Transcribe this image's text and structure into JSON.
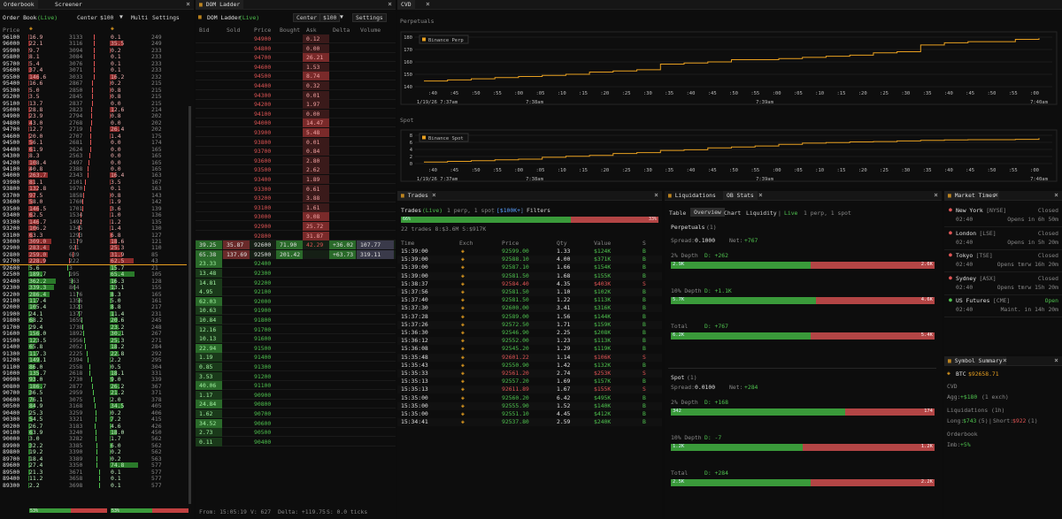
{
  "ob": {
    "tab1": "Orderbook",
    "tab2": "Screener",
    "title": "Order Book",
    "live": "(Live)",
    "center": "Center",
    "size": "$100",
    "multi": "Multi",
    "settings": "Settings",
    "price_hdr": "Price",
    "mid_price": "92700",
    "asks": [
      [
        "96100",
        "16.9",
        "3133",
        "0.1",
        "249"
      ],
      [
        "96000",
        "22.1",
        "3116",
        "35.5",
        "249"
      ],
      [
        "95900",
        "9.7",
        "3094",
        "0.2",
        "233"
      ],
      [
        "95800",
        "8.1",
        "3084",
        "0.1",
        "233"
      ],
      [
        "95700",
        "5.4",
        "3076",
        "0.1",
        "233"
      ],
      [
        "95600",
        "37.4",
        "3071",
        "0.1",
        "233"
      ],
      [
        "95500",
        "146.6",
        "3033",
        "16.2",
        "232"
      ],
      [
        "95400",
        "16.6",
        "2867",
        "0.2",
        "215"
      ],
      [
        "95300",
        "5.0",
        "2850",
        "0.8",
        "215"
      ],
      [
        "95200",
        "3.5",
        "2845",
        "0.8",
        "215"
      ],
      [
        "95100",
        "13.7",
        "2837",
        "0.0",
        "215"
      ],
      [
        "95000",
        "28.8",
        "2823",
        "12.6",
        "214"
      ],
      [
        "94900",
        "23.9",
        "2794",
        "0.8",
        "202"
      ],
      [
        "94800",
        "43.0",
        "2768",
        "0.0",
        "202"
      ],
      [
        "94700",
        "12.7",
        "2719",
        "26.4",
        "202"
      ],
      [
        "94600",
        "20.0",
        "2707",
        "1.4",
        "175"
      ],
      [
        "94500",
        "56.1",
        "2681",
        "0.0",
        "174"
      ],
      [
        "94400",
        "61.9",
        "2624",
        "0.0",
        "165"
      ],
      [
        "94300",
        "8.3",
        "2563",
        "0.0",
        "165"
      ],
      [
        "94200",
        "108.4",
        "2497",
        "0.0",
        "165"
      ],
      [
        "94100",
        "40.8",
        "2388",
        "0.0",
        "165"
      ],
      [
        "94000",
        "263.7",
        "2343",
        "16.4",
        "163"
      ],
      [
        "93900",
        "81.1",
        "2101",
        "3.5",
        "167"
      ],
      [
        "93800",
        "132.8",
        "1970",
        "0.1",
        "163"
      ],
      [
        "93700",
        "97.5",
        "1858",
        "0.8",
        "143"
      ],
      [
        "93600",
        "58.0",
        "1760",
        "1.9",
        "142"
      ],
      [
        "93500",
        "146.5",
        "1701",
        "3.6",
        "139"
      ],
      [
        "93400",
        "62.5",
        "1534",
        "1.0",
        "136"
      ],
      [
        "93300",
        "146.7",
        "1492",
        "1.2",
        "135"
      ],
      [
        "93200",
        "106.2",
        "1345",
        "1.4",
        "130"
      ],
      [
        "93100",
        "63.3",
        "1293",
        "6.8",
        "127"
      ],
      [
        "93000",
        "309.0",
        "1179",
        "18.6",
        "121"
      ],
      [
        "92900",
        "283.4",
        "921",
        "25.3",
        "110"
      ],
      [
        "92800",
        "259.0",
        "639",
        "31.9",
        "85"
      ],
      [
        "92700",
        "228.9",
        "222",
        "62.5",
        "43"
      ]
    ],
    "bids": [
      [
        "92600",
        "5.6",
        "3",
        "15.7",
        "21"
      ],
      [
        "92500",
        "189.7",
        "195",
        "65.4",
        "105"
      ],
      [
        "92400",
        "362.2",
        "563",
        "16.3",
        "128"
      ],
      [
        "92300",
        "339.3",
        "864",
        "13.1",
        "155"
      ],
      [
        "92200",
        "286.4",
        "1176",
        "8.3",
        "165"
      ],
      [
        "92100",
        "117.4",
        "1356",
        "5.0",
        "161"
      ],
      [
        "92000",
        "105.4",
        "1323",
        "8.8",
        "217"
      ],
      [
        "91900",
        "24.1",
        "1377",
        "11.4",
        "231"
      ],
      [
        "91800",
        "68.2",
        "1659",
        "20.6",
        "245"
      ],
      [
        "91700",
        "29.4",
        "1738",
        "23.2",
        "248"
      ],
      [
        "91600",
        "156.0",
        "1892",
        "30.1",
        "267"
      ],
      [
        "91500",
        "123.5",
        "1956",
        "25.3",
        "271"
      ],
      [
        "91400",
        "65.8",
        "2052",
        "18.2",
        "284"
      ],
      [
        "91300",
        "117.3",
        "2225",
        "22.8",
        "292"
      ],
      [
        "91200",
        "149.1",
        "2394",
        "2.2",
        "295"
      ],
      [
        "91100",
        "86.0",
        "2558",
        "0.5",
        "304"
      ],
      [
        "91000",
        "135.7",
        "2618",
        "18.1",
        "331"
      ],
      [
        "90900",
        "93.0",
        "2730",
        "9.0",
        "339"
      ],
      [
        "90800",
        "186.7",
        "2877",
        "26.2",
        "367"
      ],
      [
        "90700",
        "36.5",
        "2959",
        "21.2",
        "371"
      ],
      [
        "90600",
        "76.1",
        "3075",
        "2.0",
        "378"
      ],
      [
        "90500",
        "84.9",
        "3168",
        "34.5",
        "405"
      ],
      [
        "90400",
        "25.3",
        "3259",
        "0.2",
        "406"
      ],
      [
        "90300",
        "54.5",
        "3321",
        "7.2",
        "415"
      ],
      [
        "90200",
        "26.7",
        "3183",
        "4.6",
        "426"
      ],
      [
        "90100",
        "63.9",
        "3240",
        "18.0",
        "450"
      ],
      [
        "90000",
        "3.0",
        "3282",
        "1.7",
        "562"
      ],
      [
        "89900",
        "32.2",
        "3385",
        "6.0",
        "562"
      ],
      [
        "89800",
        "19.2",
        "3390",
        "0.2",
        "562"
      ],
      [
        "89700",
        "18.4",
        "3389",
        "0.2",
        "563"
      ],
      [
        "89600",
        "27.4",
        "3350",
        "74.8",
        "577"
      ],
      [
        "89500",
        "21.3",
        "3671",
        "0.1",
        "577"
      ],
      [
        "89400",
        "11.2",
        "3658",
        "0.1",
        "577"
      ],
      [
        "89300",
        "2.2",
        "3698",
        "0.1",
        "577"
      ]
    ],
    "foot1": "53%",
    "foot2": "53%"
  },
  "dom": {
    "tab": "DOM Ladder",
    "title": "DOM Ladder",
    "live": "(Live)",
    "center": "Center",
    "size": "$100",
    "settings": "Settings",
    "cols": [
      "Bid",
      "Sold",
      "Price",
      "Bought",
      "Ask",
      "Delta",
      "Volume"
    ],
    "asks": [
      [
        "94900",
        "0.12"
      ],
      [
        "94800",
        "0.00"
      ],
      [
        "94700",
        "26.21"
      ],
      [
        "94600",
        "1.53"
      ],
      [
        "94500",
        "8.74"
      ],
      [
        "94400",
        "0.32"
      ],
      [
        "94300",
        "0.01"
      ],
      [
        "94200",
        "1.97"
      ],
      [
        "94100",
        "0.00"
      ],
      [
        "94000",
        "14.47"
      ],
      [
        "93900",
        "5.48"
      ],
      [
        "93800",
        "0.01"
      ],
      [
        "93700",
        "0.84"
      ],
      [
        "93600",
        "2.80"
      ],
      [
        "93500",
        "2.62"
      ],
      [
        "93400",
        "1.89"
      ],
      [
        "93300",
        "0.61"
      ],
      [
        "93200",
        "3.88"
      ],
      [
        "93100",
        "1.61"
      ],
      [
        "93000",
        "9.08"
      ],
      [
        "92900",
        "25.72"
      ],
      [
        "92800",
        "31.87"
      ]
    ],
    "mid": [
      [
        "39.25",
        "35.87",
        "92600",
        "71.90",
        "42.29",
        "+36.02",
        "107.77"
      ],
      [
        "65.38",
        "137.69",
        "92500",
        "201.42",
        "",
        "+63.73",
        "319.11"
      ]
    ],
    "bids": [
      [
        "23.33",
        "92400"
      ],
      [
        "13.48",
        "92300"
      ],
      [
        "14.81",
        "92200"
      ],
      [
        "4.95",
        "92100"
      ],
      [
        "62.03",
        "92000"
      ],
      [
        "10.63",
        "91900"
      ],
      [
        "10.84",
        "91800"
      ],
      [
        "12.16",
        "91700"
      ],
      [
        "10.13",
        "91600"
      ],
      [
        "22.94",
        "91500"
      ],
      [
        "1.19",
        "91400"
      ],
      [
        "0.85",
        "91300"
      ],
      [
        "3.53",
        "91200"
      ],
      [
        "40.06",
        "91100"
      ],
      [
        "1.17",
        "90900"
      ],
      [
        "24.84",
        "90800"
      ],
      [
        "1.62",
        "90700"
      ],
      [
        "34.52",
        "90600"
      ],
      [
        "2.73",
        "90500"
      ],
      [
        "0.11",
        "90400"
      ]
    ],
    "footer": {
      "from": "From: 15:05:19",
      "v": "V: 627",
      "delta": "Delta: +119.75",
      "s": "S: 0.0 ticks"
    }
  },
  "cvd": {
    "tab": "CVD",
    "perp_label": "Perpetuals",
    "spot_label": "Spot",
    "perp_legend": "Binance Perp",
    "spot_legend": "Binance Spot",
    "perp_y": [
      "180",
      "170",
      "160",
      "150",
      "140"
    ],
    "spot_y": [
      "8",
      "6",
      "4",
      "2",
      "0"
    ],
    "x_ticks": [
      ":40",
      ":45",
      ":50",
      ":55",
      ":00",
      ":05",
      ":10",
      ":15",
      ":20",
      ":25",
      ":30",
      ":35",
      ":40",
      ":45",
      ":50",
      ":55",
      ":00",
      ":05",
      ":10",
      ":15",
      ":20",
      ":25",
      ":30",
      ":35",
      ":40",
      ":45",
      ":50",
      ":55",
      ":00"
    ],
    "perp_time_labels": [
      "1/19/26 7:37am",
      "7:38am",
      "7:39am",
      "7:40am"
    ],
    "spot_time_labels": [
      "1/19/26 7:37am",
      "7:38am",
      "7:39am",
      "7:40am"
    ]
  },
  "chart_data": [
    {
      "type": "line",
      "title": "Perpetuals",
      "series": [
        {
          "name": "Binance Perp",
          "values": [
            143,
            144,
            145,
            146,
            147,
            148,
            149,
            151,
            152,
            153,
            158,
            159,
            160,
            162,
            162,
            163,
            164,
            165,
            166,
            168,
            169,
            175,
            177,
            178,
            178,
            180,
            181
          ]
        }
      ],
      "ylim": [
        138,
        182
      ],
      "x_start": "7:37am",
      "x_end": "7:40am"
    },
    {
      "type": "line",
      "title": "Spot",
      "series": [
        {
          "name": "Binance Spot",
          "values": [
            0.5,
            0.7,
            0.9,
            1.2,
            1.4,
            2,
            2.3,
            2.6,
            3.2,
            3.5,
            4.2,
            4.4,
            5,
            5.3,
            5.6,
            6.1,
            6.5,
            6.7,
            6.9,
            7,
            7.2,
            7.4,
            7.5,
            7.6,
            7.6,
            7.7,
            8.1
          ]
        }
      ],
      "ylim": [
        0,
        9
      ],
      "x_start": "7:37am",
      "x_end": "7:40am"
    }
  ],
  "trades": {
    "tab": "Trades",
    "title": "Trades",
    "live": "(Live)",
    "sub": "1 perp, 1 spot",
    "filter": "[$100K+]",
    "filters": "Filters",
    "pct_left": "66%",
    "pct_right": "33%",
    "pct_value": 0.66,
    "summary": "22 trades 8:$3.6M S:$917K",
    "cols": [
      "Time",
      "Exch",
      "Price",
      "Qty",
      "Value",
      "S"
    ],
    "rows": [
      [
        "15:39:00",
        "92599.00",
        "1.33",
        "$124K",
        "B",
        "g"
      ],
      [
        "15:39:00",
        "92588.10",
        "4.00",
        "$371K",
        "B",
        "g"
      ],
      [
        "15:39:00",
        "92587.10",
        "1.66",
        "$154K",
        "B",
        "g"
      ],
      [
        "15:39:00",
        "92581.50",
        "1.68",
        "$155K",
        "B",
        "g"
      ],
      [
        "15:38:37",
        "92584.40",
        "4.35",
        "$403K",
        "S",
        "r"
      ],
      [
        "15:37:56",
        "92581.50",
        "1.10",
        "$102K",
        "B",
        "g"
      ],
      [
        "15:37:40",
        "92581.50",
        "1.22",
        "$113K",
        "B",
        "g"
      ],
      [
        "15:37:30",
        "92600.00",
        "3.41",
        "$316K",
        "B",
        "g"
      ],
      [
        "15:37:28",
        "92589.00",
        "1.56",
        "$144K",
        "B",
        "g"
      ],
      [
        "15:37:26",
        "92572.50",
        "1.71",
        "$159K",
        "B",
        "g"
      ],
      [
        "15:36:30",
        "92546.90",
        "2.25",
        "$208K",
        "B",
        "g"
      ],
      [
        "15:36:12",
        "92552.00",
        "1.23",
        "$113K",
        "B",
        "g"
      ],
      [
        "15:36:08",
        "92545.20",
        "1.29",
        "$119K",
        "B",
        "g"
      ],
      [
        "15:35:48",
        "92601.22",
        "1.14",
        "$106K",
        "S",
        "r"
      ],
      [
        "15:35:43",
        "92550.90",
        "1.42",
        "$132K",
        "B",
        "g"
      ],
      [
        "15:35:33",
        "92561.20",
        "2.74",
        "$253K",
        "S",
        "r"
      ],
      [
        "15:35:13",
        "92557.20",
        "1.69",
        "$157K",
        "B",
        "g"
      ],
      [
        "15:35:13",
        "92611.89",
        "1.67",
        "$155K",
        "S",
        "r"
      ],
      [
        "15:35:00",
        "92560.20",
        "6.42",
        "$495K",
        "B",
        "g"
      ],
      [
        "15:35:00",
        "92555.90",
        "1.52",
        "$140K",
        "B",
        "g"
      ],
      [
        "15:35:00",
        "92551.10",
        "4.45",
        "$412K",
        "B",
        "g"
      ],
      [
        "15:34:41",
        "92537.80",
        "2.59",
        "$240K",
        "B",
        "g"
      ]
    ]
  },
  "liq": {
    "tab1": "Liquidations",
    "tab2": "OB Stats",
    "t_table": "Table",
    "t_overview": "Overview",
    "t_chart": "Chart",
    "t_liquidity": "Liquidity",
    "live": "Live",
    "sub": "1 perp, 1 spot",
    "perp_title": "Perpetuals",
    "perp_count": "(1)",
    "spread_l": "Spread:",
    "spread_v": "0.1000",
    "net_l": "Net:",
    "net_v": "+767",
    "perp_rows": [
      {
        "lbl": "2% Depth",
        "d": "D: +262",
        "l": "2.9K",
        "r": "2.6K",
        "f": 0.53
      },
      {
        "lbl": "10% Depth",
        "d": "D: +1.1K",
        "l": "5.7K",
        "r": "4.6K",
        "f": 0.55
      },
      {
        "lbl": "Total",
        "d": "D: +767",
        "l": "6.2K",
        "r": "5.4K",
        "f": 0.53
      }
    ],
    "spot_title": "Spot",
    "spot_count": "(1)",
    "sspread_v": "0.0100",
    "snet_v": "+284",
    "spot_rows": [
      {
        "lbl": "2% Depth",
        "d": "D: +168",
        "l": "342",
        "r": "174",
        "f": 0.66
      },
      {
        "lbl": "10% Depth",
        "d": "D: -7",
        "l": "1.2K",
        "r": "1.2K",
        "f": 0.5
      },
      {
        "lbl": "Total",
        "d": "D: +284",
        "l": "2.5K",
        "r": "2.2K",
        "f": 0.53
      }
    ]
  },
  "mkt": {
    "tab": "Market Times",
    "rows": [
      {
        "n": "New York",
        "x": "[NYSE]",
        "s": "Closed",
        "t": "02:40",
        "o": "Opens in 6h 50m",
        "c": "#e05555"
      },
      {
        "n": "London",
        "x": "[LSE]",
        "s": "Closed",
        "t": "02:40",
        "o": "Opens in 5h 20m",
        "c": "#e05555"
      },
      {
        "n": "Tokyo",
        "x": "[TSE]",
        "s": "Closed",
        "t": "02:40",
        "o": "Opens tmrw 16h 20m",
        "c": "#e05555"
      },
      {
        "n": "Sydney",
        "x": "[ASX]",
        "s": "Closed",
        "t": "02:40",
        "o": "Opens tmrw 15h 20m",
        "c": "#e05555"
      },
      {
        "n": "US Futures",
        "x": "[CME]",
        "s": "Open",
        "t": "02:40",
        "o": "Maint. in 14h 20m",
        "c": "#4fc34f"
      }
    ]
  },
  "sym": {
    "tab": "Symbol Summary",
    "coin": "BTC",
    "price": "$92658.71",
    "cvd": "CVD",
    "agg": "Agg:",
    "agg_v": "+$180",
    "agg_n": "(1 exch)",
    "liq": "Liquidations (1h)",
    "long": "Long:",
    "long_v": "$743",
    "long_n": "(5)",
    "short": "Short:",
    "short_v": "$922",
    "short_n": "(1)",
    "ob": "Orderbook",
    "imb": "Imb:",
    "imb_v": "+5%"
  },
  "colors": {
    "green": "#4fc34f",
    "red": "#e05555",
    "gold": "#e8a020"
  }
}
